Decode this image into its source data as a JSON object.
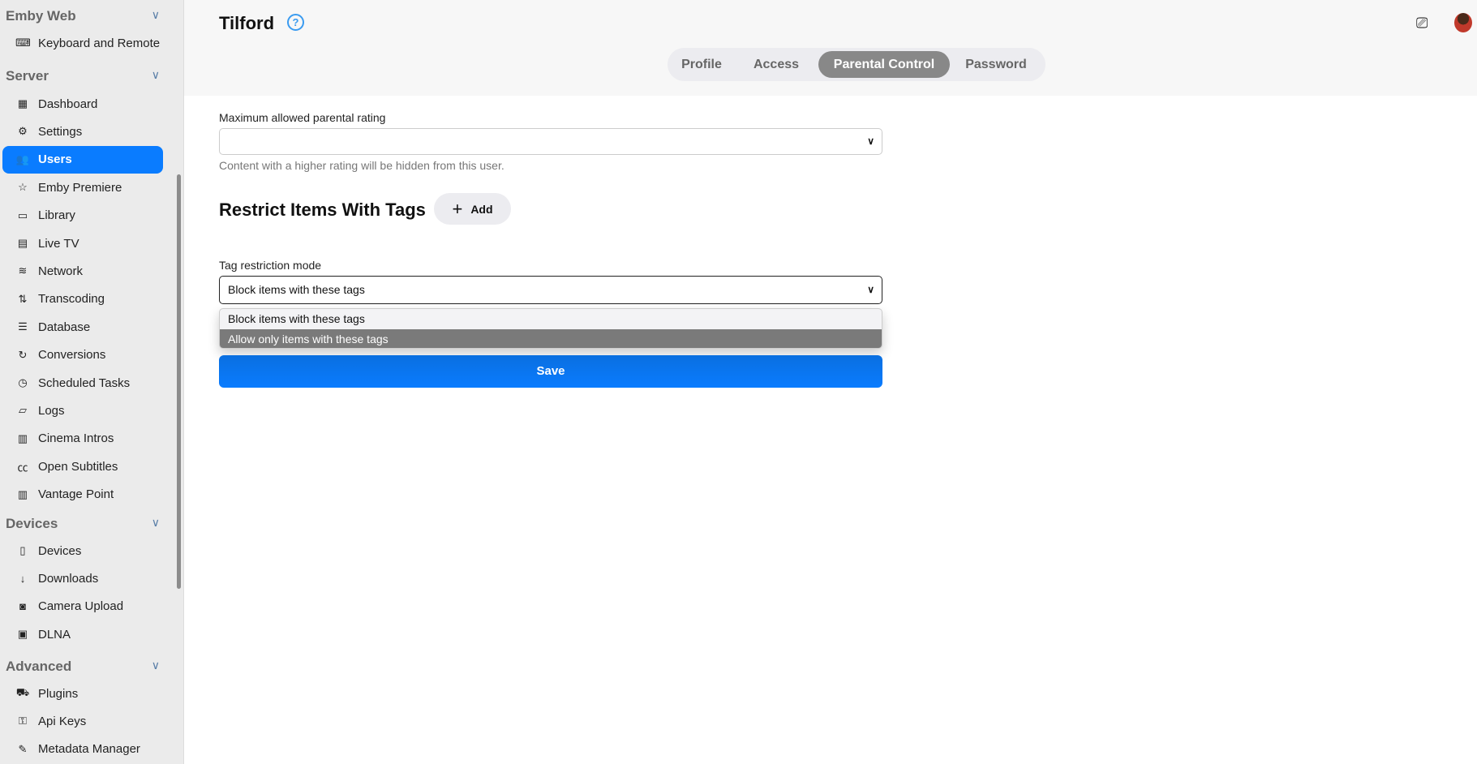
{
  "sidebar": {
    "sections": [
      {
        "title": "Emby Web",
        "items": [
          {
            "label": "Keyboard and Remote",
            "icon": "keyboard-icon"
          }
        ]
      },
      {
        "title": "Server",
        "items": [
          {
            "label": "Dashboard",
            "icon": "dashboard-icon"
          },
          {
            "label": "Settings",
            "icon": "gear-icon"
          },
          {
            "label": "Users",
            "icon": "users-icon",
            "active": true
          },
          {
            "label": "Emby Premiere",
            "icon": "star-icon"
          },
          {
            "label": "Library",
            "icon": "folder-icon"
          },
          {
            "label": "Live TV",
            "icon": "tv-icon"
          },
          {
            "label": "Network",
            "icon": "wifi-icon"
          },
          {
            "label": "Transcoding",
            "icon": "transcode-icon"
          },
          {
            "label": "Database",
            "icon": "database-icon"
          },
          {
            "label": "Conversions",
            "icon": "sync-icon"
          },
          {
            "label": "Scheduled Tasks",
            "icon": "clock-icon"
          },
          {
            "label": "Logs",
            "icon": "folder-open-icon"
          },
          {
            "label": "Cinema Intros",
            "icon": "film-icon"
          },
          {
            "label": "Open Subtitles",
            "icon": "cc-icon"
          },
          {
            "label": "Vantage Point",
            "icon": "film-icon"
          }
        ]
      },
      {
        "title": "Devices",
        "items": [
          {
            "label": "Devices",
            "icon": "devices-icon"
          },
          {
            "label": "Downloads",
            "icon": "download-icon"
          },
          {
            "label": "Camera Upload",
            "icon": "camera-icon"
          },
          {
            "label": "DLNA",
            "icon": "dlna-icon"
          }
        ]
      },
      {
        "title": "Advanced",
        "items": [
          {
            "label": "Plugins",
            "icon": "cart-icon"
          },
          {
            "label": "Api Keys",
            "icon": "key-icon"
          },
          {
            "label": "Metadata Manager",
            "icon": "pencil-icon"
          }
        ]
      }
    ]
  },
  "header": {
    "title": "Tilford",
    "help": "?"
  },
  "tabs": [
    {
      "label": "Profile"
    },
    {
      "label": "Access"
    },
    {
      "label": "Parental Control",
      "active": true
    },
    {
      "label": "Password"
    }
  ],
  "form": {
    "rating_label": "Maximum allowed parental rating",
    "rating_value": "",
    "rating_hint": "Content with a higher rating will be hidden from this user.",
    "tags_heading": "Restrict Items With Tags",
    "add_label": "Add",
    "mode_label": "Tag restriction mode",
    "mode_value": "Block items with these tags",
    "mode_options": [
      "Block items with these tags",
      "Allow only items with these tags"
    ],
    "highlighted_option": 1,
    "save_label": "Save"
  },
  "colors": {
    "accent": "#0a7cff",
    "active_tab": "#888888"
  }
}
